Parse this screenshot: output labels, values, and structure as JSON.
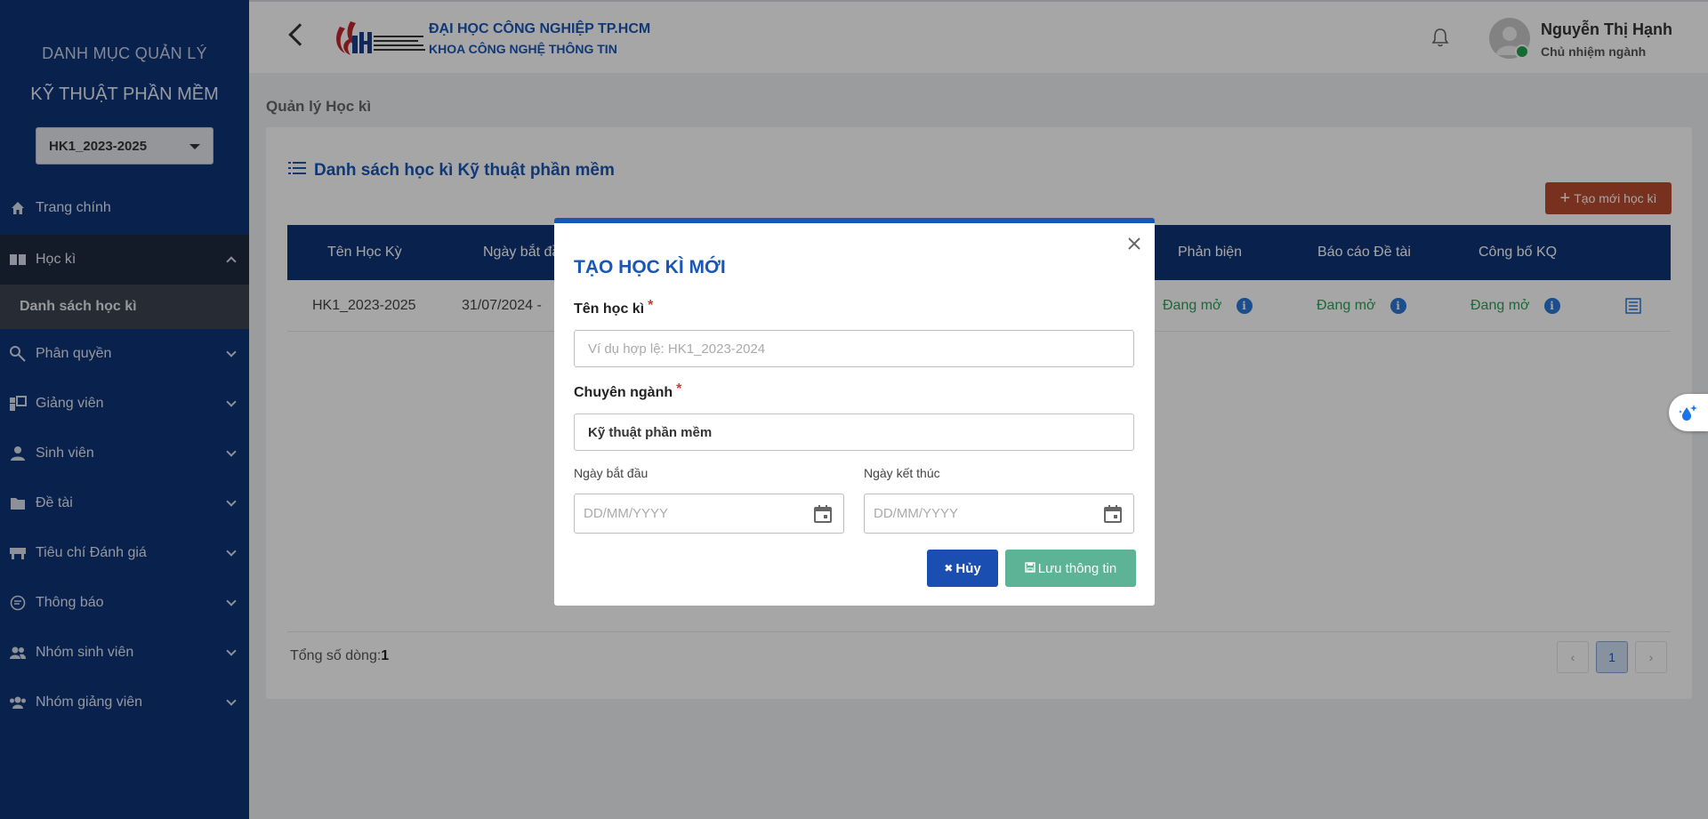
{
  "sidebar": {
    "title_line1": "DANH MỤC QUẢN LÝ",
    "title_line2": "KỸ THUẬT PHẦN MỀM",
    "semester_select": "HK1_2023-2025",
    "items": [
      {
        "label": "Trang chính",
        "icon": "home-icon"
      },
      {
        "label": "Học kì",
        "icon": "book-icon",
        "expanded": true
      },
      {
        "label": "Phân quyền",
        "icon": "key-icon"
      },
      {
        "label": "Giảng viên",
        "icon": "teacher-icon"
      },
      {
        "label": "Sinh viên",
        "icon": "student-icon"
      },
      {
        "label": "Đề tài",
        "icon": "folder-icon"
      },
      {
        "label": "Tiêu chí Đánh giá",
        "icon": "desk-icon"
      },
      {
        "label": "Thông báo",
        "icon": "message-icon"
      },
      {
        "label": "Nhóm sinh viên",
        "icon": "group-icon"
      },
      {
        "label": "Nhóm giảng viên",
        "icon": "team-icon"
      }
    ],
    "subitem": "Danh sách học kì"
  },
  "header": {
    "school_name": "ĐẠI HỌC CÔNG NGHIỆP TP.HCM",
    "faculty": "KHOA CÔNG NGHỆ THÔNG TIN",
    "user_name": "Nguyễn Thị Hạnh",
    "user_role": "Chủ nhiệm ngành"
  },
  "main": {
    "page_title": "Quản lý Học kì",
    "card_title": "Danh sách học kì Kỹ thuật phần mềm",
    "new_button": "Tạo mới học kì",
    "columns": [
      "Tên Học Kỳ",
      "Ngày bắt đầ",
      "Phản biện",
      "Báo cáo Đề tài",
      "Công bố KQ"
    ],
    "row": {
      "name": "HK1_2023-2025",
      "start": "31/07/2024  -",
      "review": "Đang mở",
      "report": "Đang mở",
      "publish": "Đang mở"
    },
    "total_label": "Tổng số dòng:",
    "total_value": "1",
    "current_page": "1"
  },
  "modal": {
    "title": "TẠO HỌC KÌ MỚI",
    "name_label": "Tên học kì",
    "name_placeholder": "Ví dụ hợp lệ: HK1_2023-2024",
    "major_label": "Chuyên ngành",
    "major_value": "Kỹ thuật phần mềm",
    "start_label": "Ngày bắt đầu",
    "end_label": "Ngày kết thúc",
    "date_placeholder": "DD/MM/YYYY",
    "cancel_label": "Hủy",
    "save_label": "Lưu thông tin",
    "required_mark": "*"
  },
  "colors": {
    "sidebar_bg": "#0e3377",
    "accent": "#1a56b5",
    "create_button": "#b84a30",
    "save_button": "#5cb396",
    "status_open": "#2e9e5a"
  }
}
